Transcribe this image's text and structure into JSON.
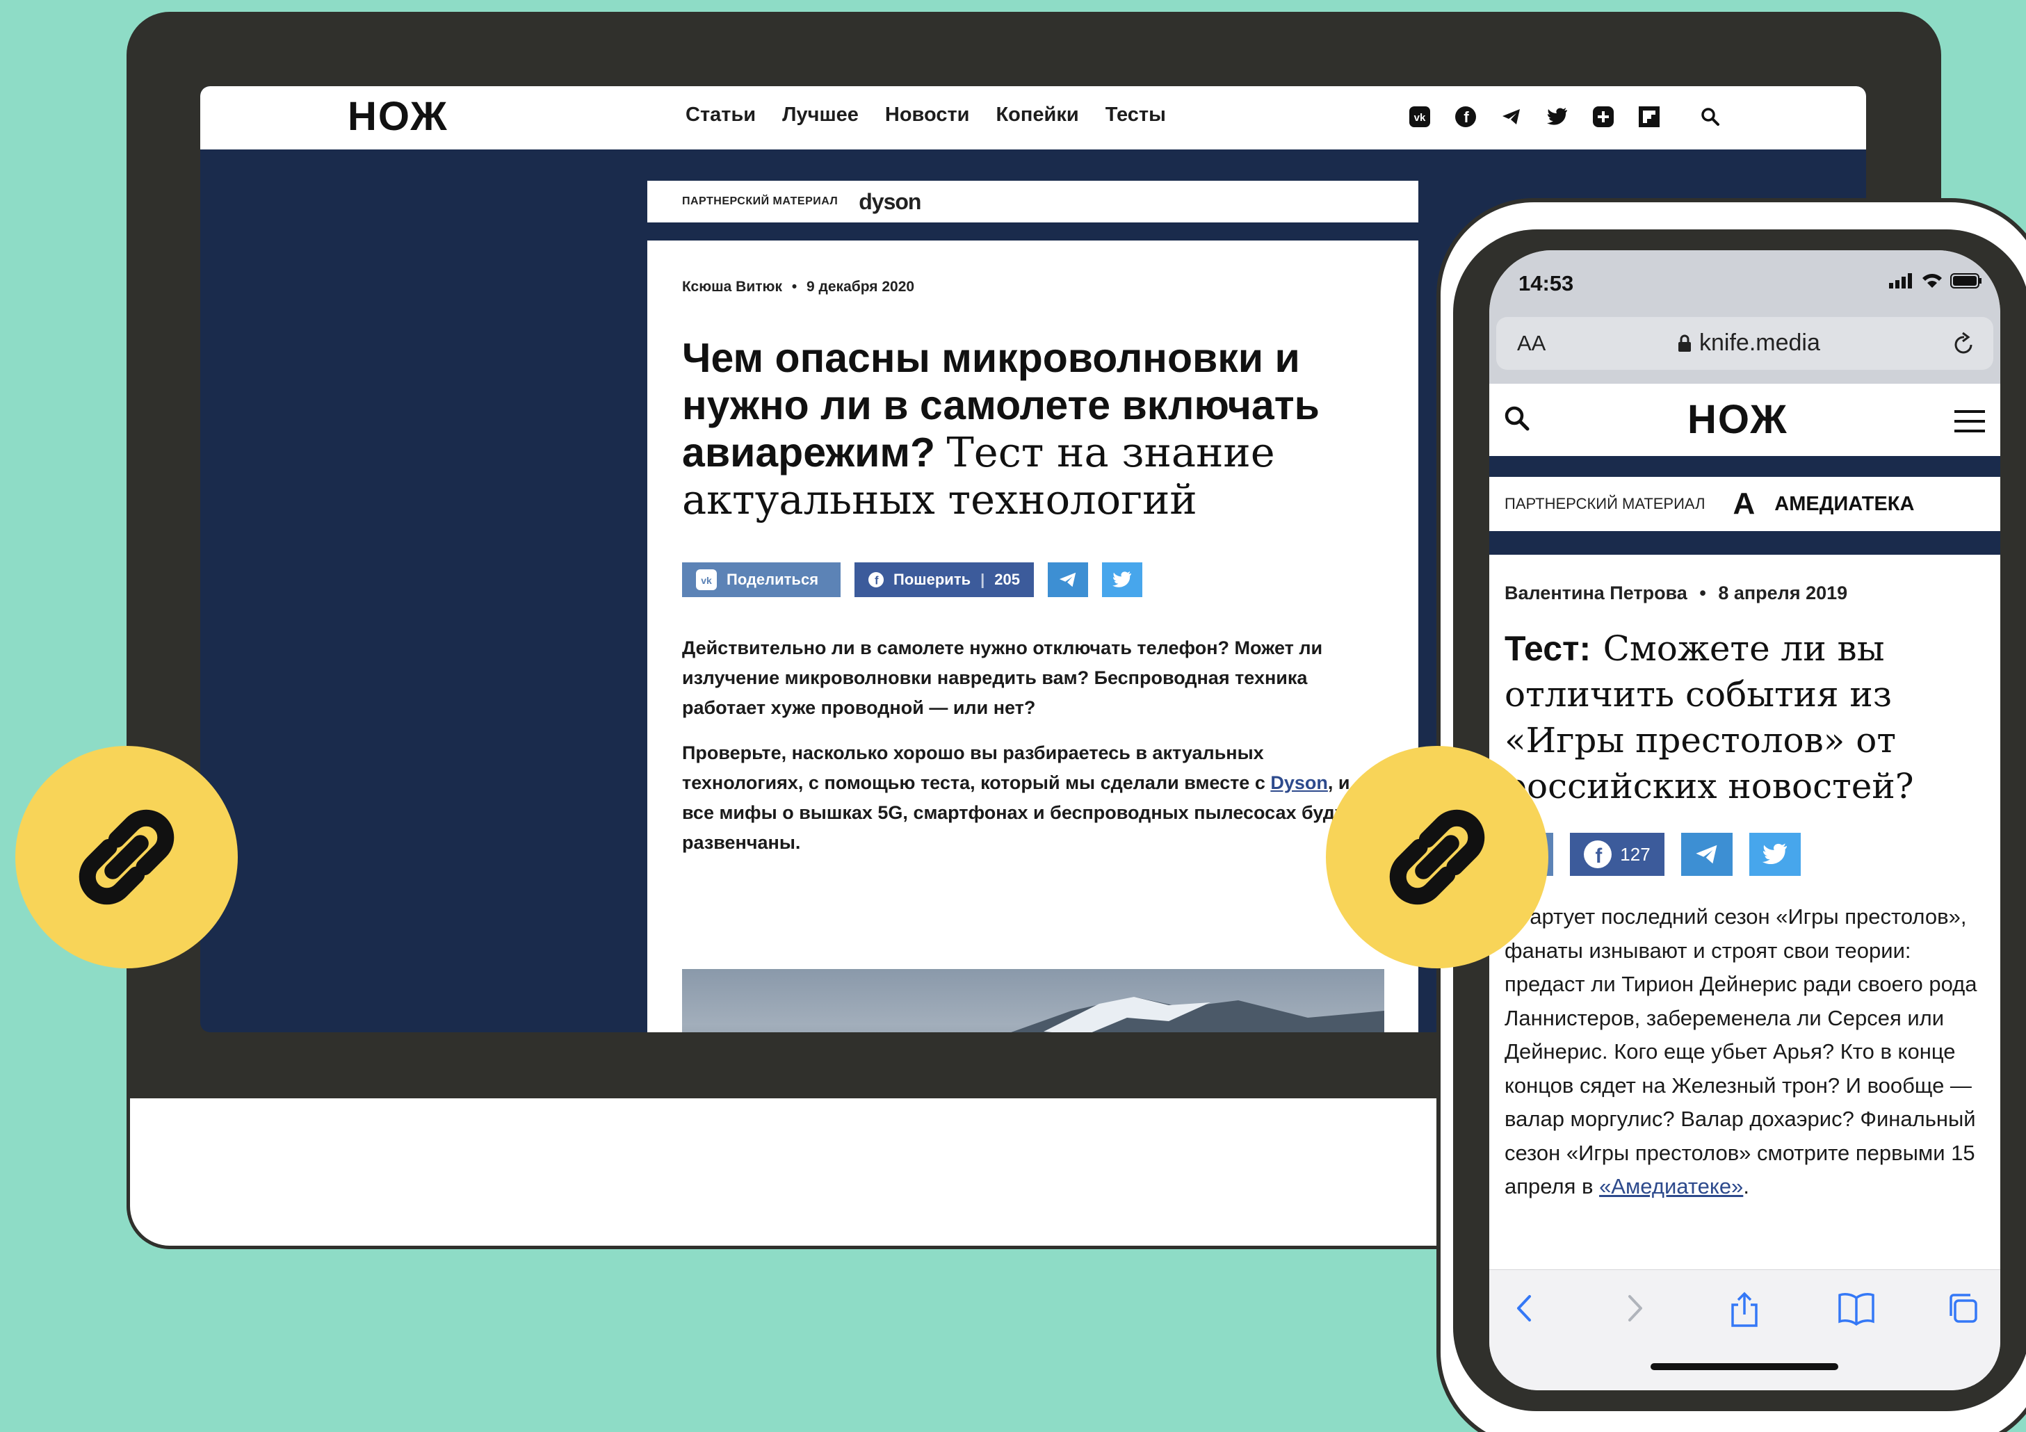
{
  "desktop": {
    "logo": "НОЖ",
    "nav": [
      "Статьи",
      "Лучшее",
      "Новости",
      "Копейки",
      "Тесты"
    ],
    "social_icons": [
      "vk-icon",
      "facebook-icon",
      "telegram-icon",
      "twitter-icon",
      "plus-icon",
      "flipboard-icon"
    ],
    "search_icon": "search-icon",
    "partner_label": "ПАРТНЕРСКИЙ МАТЕРИАЛ",
    "partner_brand": "dyson",
    "author": "Ксюша Витюк",
    "date": "9 декабря 2020",
    "headline_bold": "Чем опасны микроволновки и нужно ли в самолете включать авиарежим?",
    "headline_serif": "Тест на знание актуальных технологий",
    "share": {
      "vk_label": "Поделиться",
      "fb_label": "Пошерить",
      "fb_count": "205"
    },
    "para1": "Действительно ли в самолете нужно отключать телефон? Может ли излучение микроволновки навредить вам? Беспроводная техника работает хуже проводной — или нет?",
    "para2_before": "Проверьте, насколько хорошо вы разбираетесь в актуальных технологиях, с помощью теста, который мы сделали вместе с ",
    "para2_link": "Dyson",
    "para2_after": ", и все мифы о вышках 5G, смартфонах и беспроводных пылесосах будут развенчаны."
  },
  "mobile": {
    "time": "14:53",
    "aa": "AA",
    "url": "knife.media",
    "logo": "НОЖ",
    "partner_label": "ПАРТНЕРСКИЙ МАТЕРИАЛ",
    "partner_logo_letter": "А",
    "partner_name": "АМЕДИАТЕКА",
    "author": "Валентина Петрова",
    "date": "8 апреля 2019",
    "headline_bold": "Тест:",
    "headline_serif": "Сможете ли вы отличить события из «Игры престолов» от российских новостей?",
    "fb_count": "127",
    "body_before": "Стартует последний сезон «Игры престолов», фанаты изнывают и строят свои теории: предаст ли Тирион Дейнерис ради своего рода Ланнистеров, забеременела ли Серсея или Дейнерис. Кого еще убьет Арья? Кто в конце концов сядет на Железный трон? И вообще — валар моргулис? Валар дохаэрис? Финальный сезон «Игры престолов» смотрите первыми 15 апреля в ",
    "body_link": "«Амедиатеке»",
    "body_after": "."
  },
  "colors": {
    "background": "#8edcc6",
    "device": "#30302c",
    "navy": "#1a2b4c",
    "badge": "#f8d458",
    "vk": "#5c83b6",
    "facebook": "#3c5b9b",
    "telegram": "#3d8fd3",
    "twitter": "#47a6ec"
  }
}
